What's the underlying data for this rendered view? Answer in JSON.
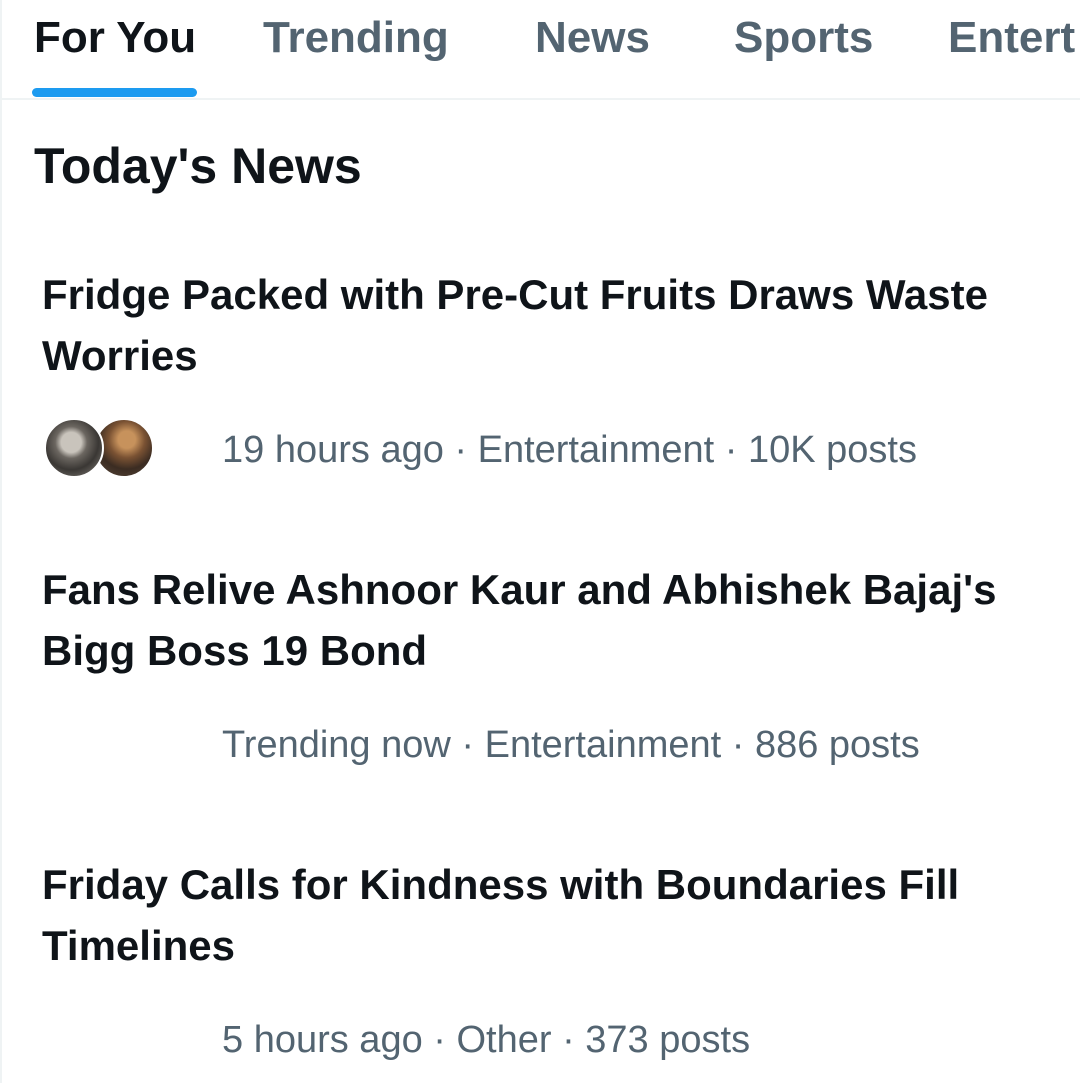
{
  "tabs": [
    {
      "label": "For You",
      "active": true
    },
    {
      "label": "Trending",
      "active": false
    },
    {
      "label": "News",
      "active": false
    },
    {
      "label": "Sports",
      "active": false
    },
    {
      "label": "Entert",
      "active": false
    }
  ],
  "section_title": "Today's News",
  "items": [
    {
      "headline": "Fridge Packed with Pre-Cut Fruits Draws Waste Worries",
      "meta": "19 hours ago · Entertainment · 10K posts",
      "has_avatars": true
    },
    {
      "headline": "Fans Relive Ashnoor Kaur and Abhishek Bajaj's Bigg Boss 19 Bond",
      "meta": "Trending now · Entertainment · 886 posts",
      "has_avatars": false
    },
    {
      "headline": "Friday Calls for Kindness with Boundaries Fill Timelines",
      "meta": "5 hours ago · Other · 373 posts",
      "has_avatars": false
    }
  ],
  "colors": {
    "accent": "#1d9bf0",
    "text_primary": "#0f1419",
    "text_secondary": "#536471",
    "divider": "#eff3f4"
  }
}
